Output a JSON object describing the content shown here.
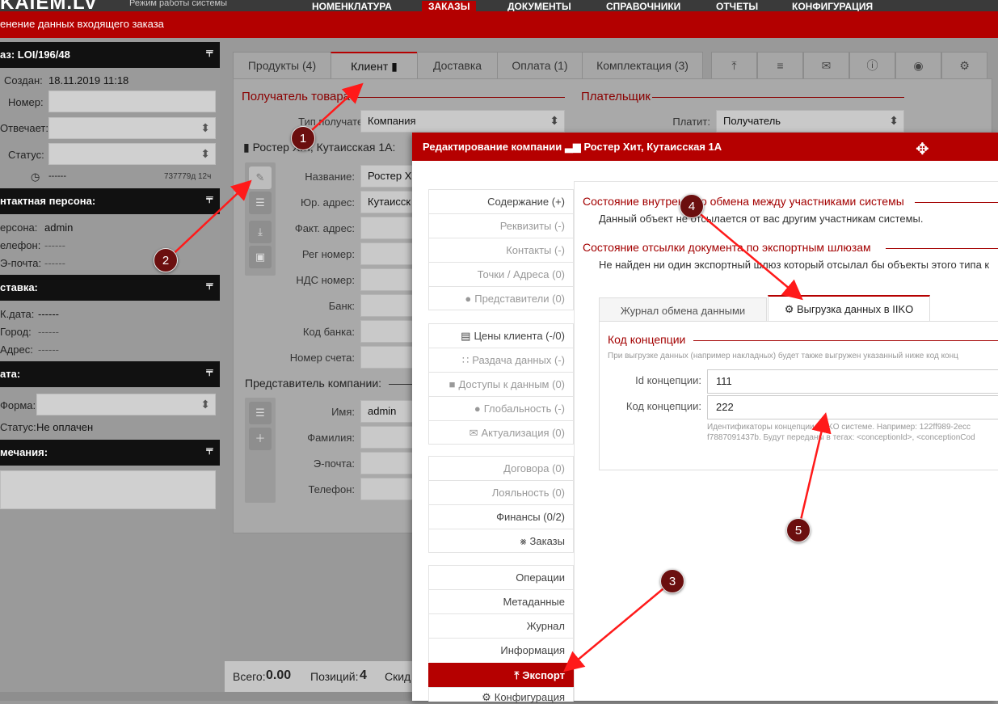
{
  "app": {
    "brand": "KAIEM.LV",
    "brand_sub": "Режим работы системы",
    "nav": [
      "НОМЕНКЛАТУРА",
      "ЗАКАЗЫ",
      "ДОКУМЕНТЫ",
      "СПРАВОЧНИКИ",
      "ОТЧЕТЫ",
      "КОНФИГУРАЦИЯ"
    ]
  },
  "window": {
    "title": "енение данных входящего заказа"
  },
  "order": {
    "header": "аз: LOI/196/48",
    "created_label": "Создан:",
    "created_value": "18.11.2019 11:18",
    "number_label": "Номер:",
    "responsible_label": "Отвечает:",
    "status_label": "Статус:",
    "timer_value": "------",
    "age_value": "737779д 12ч"
  },
  "contact": {
    "header": "нтактная персона:",
    "person_label": "ерсона:",
    "person_value": "admin",
    "phone_label": "елефон:",
    "phone_value": "------",
    "email_label": "Э-почта:",
    "email_value": "------"
  },
  "delivery": {
    "header": "ставка:",
    "date_label": "К.дата:",
    "date_value": "------",
    "city_label": "Город:",
    "city_value": "------",
    "address_label": "Адрес:",
    "address_value": "------"
  },
  "payment_block": {
    "header": "ата:",
    "form_label": "Форма:",
    "status_label": "Статус:",
    "status_value": "Не оплачен"
  },
  "notes": {
    "header": "мечания:"
  },
  "tabs": [
    {
      "label": "Продукты (4)"
    },
    {
      "label": "Клиент"
    },
    {
      "label": "Доставка"
    },
    {
      "label": "Оплата (1)"
    },
    {
      "label": "Комплектация (3)"
    }
  ],
  "client_panel": {
    "recipient_title": "Получатель товара",
    "payer_title": "Плательщик",
    "recipient_type_label": "Тип получателя:",
    "recipient_type_value": "Компания",
    "pays_label": "Платит:",
    "pays_value": "Получатель",
    "company_line": "Ростер Хит, Кутаисская 1А:",
    "fields": [
      {
        "label": "Название:",
        "value": "Ростер Хи"
      },
      {
        "label": "Юр. адрес:",
        "value": "Кутаисск"
      },
      {
        "label": "Факт. адрес:",
        "value": ""
      },
      {
        "label": "Рег номер:",
        "value": ""
      },
      {
        "label": "НДС номер:",
        "value": ""
      },
      {
        "label": "Банк:",
        "value": ""
      },
      {
        "label": "Код банка:",
        "value": ""
      },
      {
        "label": "Номер счета:",
        "value": ""
      }
    ],
    "rep_title": "Представитель компании:",
    "rep_fields": [
      {
        "label": "Имя:",
        "value": "admin"
      },
      {
        "label": "Фамилия:",
        "value": ""
      },
      {
        "label": "Э-почта:",
        "value": ""
      },
      {
        "label": "Телефон:",
        "value": ""
      }
    ]
  },
  "footer": {
    "total_label": "Всего:",
    "total_value": "0.00",
    "items_label": "Позиций:",
    "items_value": "4",
    "discount_label": "Скид"
  },
  "modal": {
    "title_prefix": "Редактирование компании",
    "title_entity": "Ростер Хит, Кутаисская 1А",
    "nav": [
      {
        "label": "Содержание (+)"
      },
      {
        "label": "Реквизиты (-)"
      },
      {
        "label": "Контакты (-)"
      },
      {
        "label": "Точки / Адреса (0)"
      },
      {
        "label": "Представители (0)"
      },
      {
        "label": "Цены клиента (-/0)"
      },
      {
        "label": "Раздача данных (-)"
      },
      {
        "label": "Доступы к данным (0)"
      },
      {
        "label": "Глобальность (-)"
      },
      {
        "label": "Актуализация (0)"
      },
      {
        "label": "Договора (0)"
      },
      {
        "label": "Лояльность (0)"
      },
      {
        "label": "Финансы (0/2)"
      },
      {
        "label": "Заказы"
      },
      {
        "label": "Операции"
      },
      {
        "label": "Метаданные"
      },
      {
        "label": "Журнал"
      },
      {
        "label": "Информация"
      },
      {
        "label": "Экспорт"
      },
      {
        "label": "Конфигурация"
      }
    ],
    "internal_title": "Состояние внутреннего обмена между участниками системы",
    "internal_text": "Данный объект не отсылается от вас другим участникам системы.",
    "export_title": "Состояние отсылки документа по экспортным шлюзам",
    "export_text": "Не найден ни один экспортный шлюз который отсылал бы объекты этого типа к",
    "tab_journal": "Журнал обмена данными",
    "tab_iiko": "Выгрузка данных в IIKO",
    "concept_title": "Код концепции",
    "concept_hint": "При выгрузке данных (например накладных) будет также выгружен указанный ниже код конц",
    "id_label": "Id концепции:",
    "id_value": "111",
    "code_label": "Код концепции:",
    "code_value": "222",
    "help_line1": "Идентификаторы концепции в IIKO системе. Например: 122ff989-2ecc",
    "help_line2": "f7887091437b. Будут переданы в тегах: <conceptionId>, <conceptionCod"
  },
  "annotations": [
    "1",
    "2",
    "3",
    "4",
    "5"
  ],
  "colors": {
    "accent": "#b50000",
    "header_dark": "#111111",
    "marker": "#6b0f0f",
    "arrow": "#ff0000"
  }
}
